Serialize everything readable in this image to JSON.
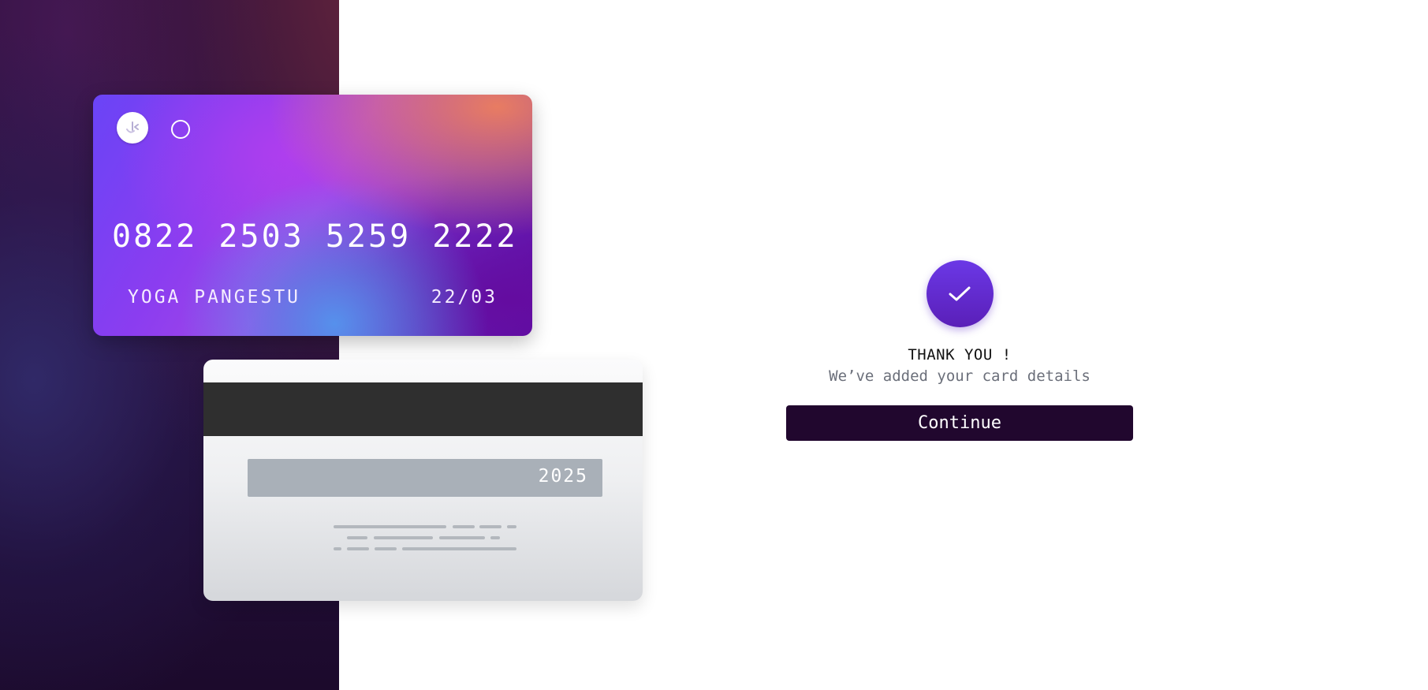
{
  "card_front": {
    "number": "0822 2503 5259 2222",
    "holder": "YOGA PANGESTU",
    "expiry": "22/03",
    "logo_icon": "brand-logo-icon",
    "contactless_icon": "circle-icon"
  },
  "card_back": {
    "cvv": "2025"
  },
  "success": {
    "icon": "check-icon",
    "title": "THANK YOU !",
    "subtitle": "We’ve added your card details",
    "continue_label": "Continue"
  },
  "colors": {
    "button_bg": "#21072e",
    "check_circle": "#5f2bd0",
    "subtitle": "#6b6f7a"
  }
}
